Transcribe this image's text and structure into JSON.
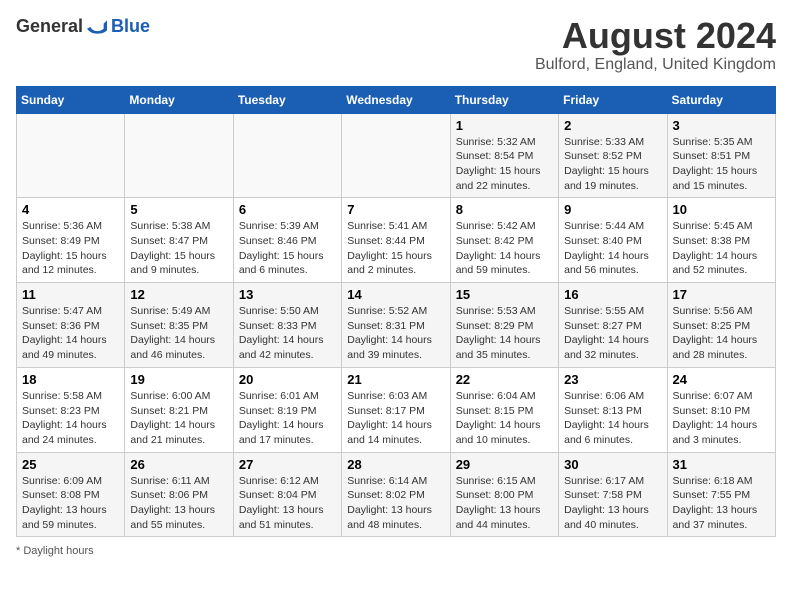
{
  "header": {
    "logo_general": "General",
    "logo_blue": "Blue",
    "title": "August 2024",
    "subtitle": "Bulford, England, United Kingdom"
  },
  "footer": {
    "note": "Daylight hours"
  },
  "calendar": {
    "days_of_week": [
      "Sunday",
      "Monday",
      "Tuesday",
      "Wednesday",
      "Thursday",
      "Friday",
      "Saturday"
    ],
    "weeks": [
      [
        {
          "day": "",
          "info": ""
        },
        {
          "day": "",
          "info": ""
        },
        {
          "day": "",
          "info": ""
        },
        {
          "day": "",
          "info": ""
        },
        {
          "day": "1",
          "info": "Sunrise: 5:32 AM\nSunset: 8:54 PM\nDaylight: 15 hours and 22 minutes."
        },
        {
          "day": "2",
          "info": "Sunrise: 5:33 AM\nSunset: 8:52 PM\nDaylight: 15 hours and 19 minutes."
        },
        {
          "day": "3",
          "info": "Sunrise: 5:35 AM\nSunset: 8:51 PM\nDaylight: 15 hours and 15 minutes."
        }
      ],
      [
        {
          "day": "4",
          "info": "Sunrise: 5:36 AM\nSunset: 8:49 PM\nDaylight: 15 hours and 12 minutes."
        },
        {
          "day": "5",
          "info": "Sunrise: 5:38 AM\nSunset: 8:47 PM\nDaylight: 15 hours and 9 minutes."
        },
        {
          "day": "6",
          "info": "Sunrise: 5:39 AM\nSunset: 8:46 PM\nDaylight: 15 hours and 6 minutes."
        },
        {
          "day": "7",
          "info": "Sunrise: 5:41 AM\nSunset: 8:44 PM\nDaylight: 15 hours and 2 minutes."
        },
        {
          "day": "8",
          "info": "Sunrise: 5:42 AM\nSunset: 8:42 PM\nDaylight: 14 hours and 59 minutes."
        },
        {
          "day": "9",
          "info": "Sunrise: 5:44 AM\nSunset: 8:40 PM\nDaylight: 14 hours and 56 minutes."
        },
        {
          "day": "10",
          "info": "Sunrise: 5:45 AM\nSunset: 8:38 PM\nDaylight: 14 hours and 52 minutes."
        }
      ],
      [
        {
          "day": "11",
          "info": "Sunrise: 5:47 AM\nSunset: 8:36 PM\nDaylight: 14 hours and 49 minutes."
        },
        {
          "day": "12",
          "info": "Sunrise: 5:49 AM\nSunset: 8:35 PM\nDaylight: 14 hours and 46 minutes."
        },
        {
          "day": "13",
          "info": "Sunrise: 5:50 AM\nSunset: 8:33 PM\nDaylight: 14 hours and 42 minutes."
        },
        {
          "day": "14",
          "info": "Sunrise: 5:52 AM\nSunset: 8:31 PM\nDaylight: 14 hours and 39 minutes."
        },
        {
          "day": "15",
          "info": "Sunrise: 5:53 AM\nSunset: 8:29 PM\nDaylight: 14 hours and 35 minutes."
        },
        {
          "day": "16",
          "info": "Sunrise: 5:55 AM\nSunset: 8:27 PM\nDaylight: 14 hours and 32 minutes."
        },
        {
          "day": "17",
          "info": "Sunrise: 5:56 AM\nSunset: 8:25 PM\nDaylight: 14 hours and 28 minutes."
        }
      ],
      [
        {
          "day": "18",
          "info": "Sunrise: 5:58 AM\nSunset: 8:23 PM\nDaylight: 14 hours and 24 minutes."
        },
        {
          "day": "19",
          "info": "Sunrise: 6:00 AM\nSunset: 8:21 PM\nDaylight: 14 hours and 21 minutes."
        },
        {
          "day": "20",
          "info": "Sunrise: 6:01 AM\nSunset: 8:19 PM\nDaylight: 14 hours and 17 minutes."
        },
        {
          "day": "21",
          "info": "Sunrise: 6:03 AM\nSunset: 8:17 PM\nDaylight: 14 hours and 14 minutes."
        },
        {
          "day": "22",
          "info": "Sunrise: 6:04 AM\nSunset: 8:15 PM\nDaylight: 14 hours and 10 minutes."
        },
        {
          "day": "23",
          "info": "Sunrise: 6:06 AM\nSunset: 8:13 PM\nDaylight: 14 hours and 6 minutes."
        },
        {
          "day": "24",
          "info": "Sunrise: 6:07 AM\nSunset: 8:10 PM\nDaylight: 14 hours and 3 minutes."
        }
      ],
      [
        {
          "day": "25",
          "info": "Sunrise: 6:09 AM\nSunset: 8:08 PM\nDaylight: 13 hours and 59 minutes."
        },
        {
          "day": "26",
          "info": "Sunrise: 6:11 AM\nSunset: 8:06 PM\nDaylight: 13 hours and 55 minutes."
        },
        {
          "day": "27",
          "info": "Sunrise: 6:12 AM\nSunset: 8:04 PM\nDaylight: 13 hours and 51 minutes."
        },
        {
          "day": "28",
          "info": "Sunrise: 6:14 AM\nSunset: 8:02 PM\nDaylight: 13 hours and 48 minutes."
        },
        {
          "day": "29",
          "info": "Sunrise: 6:15 AM\nSunset: 8:00 PM\nDaylight: 13 hours and 44 minutes."
        },
        {
          "day": "30",
          "info": "Sunrise: 6:17 AM\nSunset: 7:58 PM\nDaylight: 13 hours and 40 minutes."
        },
        {
          "day": "31",
          "info": "Sunrise: 6:18 AM\nSunset: 7:55 PM\nDaylight: 13 hours and 37 minutes."
        }
      ]
    ]
  }
}
